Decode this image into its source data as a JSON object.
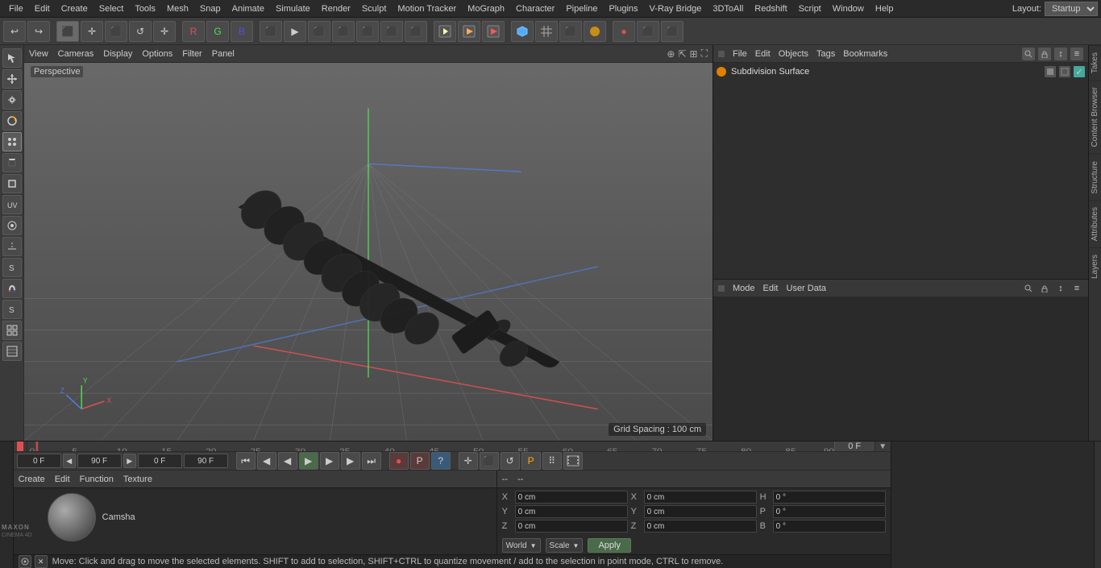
{
  "app": {
    "title": "Cinema 4D"
  },
  "menubar": {
    "items": [
      "File",
      "Edit",
      "Create",
      "Select",
      "Tools",
      "Mesh",
      "Snap",
      "Animate",
      "Simulate",
      "Render",
      "Sculpt",
      "Motion Tracker",
      "MoGraph",
      "Character",
      "Pipeline",
      "Plugins",
      "V-Ray Bridge",
      "3DToAll",
      "Redshift",
      "Script",
      "Window",
      "Help"
    ]
  },
  "layout": {
    "label": "Layout:",
    "value": "Startup"
  },
  "toolbar": {
    "buttons": [
      "↩",
      "↩",
      "⬛",
      "✛",
      "⬛",
      "↺",
      "✛",
      "R",
      "G",
      "B",
      "⬛",
      "▶",
      "⬛",
      "⬛",
      "⬛",
      "⬛",
      "⬛",
      "⬛",
      "⬛",
      "⬛",
      "⬛",
      "⬛",
      "⬛",
      "⬛",
      "⬛",
      "⬛",
      "⬛",
      "⬛",
      "⬛",
      "⬛"
    ]
  },
  "left_toolbar": {
    "buttons": [
      "⬛",
      "✛",
      "⬛",
      "⬛",
      "⬛",
      "⬛",
      "⬛",
      "⬛",
      "⬛",
      "⬛",
      "⬛",
      "⬛",
      "⬛",
      "⬛",
      "⬛",
      "⬛",
      "⬛",
      "⬛",
      "⬛"
    ]
  },
  "viewport": {
    "menus": [
      "View",
      "Cameras",
      "Display",
      "Options",
      "Filter",
      "Panel"
    ],
    "perspective_label": "Perspective",
    "grid_spacing": "Grid Spacing : 100 cm"
  },
  "object_manager": {
    "tabs": [
      "File",
      "Edit",
      "Objects",
      "Tags",
      "Bookmarks"
    ],
    "object_name": "Subdivision Surface"
  },
  "attributes": {
    "tabs": [
      "Mode",
      "Edit",
      "User Data"
    ]
  },
  "side_tabs": {
    "items": [
      "Takes",
      "Content Browser",
      "Structure",
      "Attributes",
      "Layers"
    ]
  },
  "timeline": {
    "ticks": [
      0,
      5,
      10,
      15,
      20,
      25,
      30,
      35,
      40,
      45,
      50,
      55,
      60,
      65,
      70,
      75,
      80,
      85,
      90
    ],
    "current_frame": "0 F"
  },
  "transport": {
    "start_frame": "0 F",
    "end_frame": "90 F",
    "preview_start": "0 F",
    "preview_end": "90 F",
    "buttons": [
      "⏮",
      "⏪",
      "⏪",
      "▶",
      "⏩",
      "⏩",
      "⏭"
    ]
  },
  "material": {
    "menus": [
      "Create",
      "Edit",
      "Function",
      "Texture"
    ],
    "name": "Camsha",
    "sphere_desc": "material sphere preview"
  },
  "coordinates": {
    "menus": [
      "--",
      "--"
    ],
    "fields": [
      {
        "label": "X",
        "value": "0 cm",
        "axis": "pos"
      },
      {
        "label": "Y",
        "value": "0 cm",
        "axis": "pos"
      },
      {
        "label": "Z",
        "value": "0 cm",
        "axis": "pos"
      },
      {
        "label": "X",
        "value": "0 cm",
        "axis": "size"
      },
      {
        "label": "Y",
        "value": "0 cm",
        "axis": "size"
      },
      {
        "label": "Z",
        "value": "0 cm",
        "axis": "size"
      },
      {
        "label": "H",
        "value": "0 °",
        "axis": "rot"
      },
      {
        "label": "P",
        "value": "0 °",
        "axis": "rot"
      },
      {
        "label": "B",
        "value": "0 °",
        "axis": "rot"
      }
    ],
    "row1": [
      {
        "label": "X",
        "value": "0 cm"
      },
      {
        "label": "X",
        "value": "0 cm"
      },
      {
        "label": "H",
        "value": "0 °"
      }
    ],
    "row2": [
      {
        "label": "Y",
        "value": "0 cm"
      },
      {
        "label": "Y",
        "value": "0 cm"
      },
      {
        "label": "P",
        "value": "0 °"
      }
    ],
    "row3": [
      {
        "label": "Z",
        "value": "0 cm"
      },
      {
        "label": "Z",
        "value": "0 cm"
      },
      {
        "label": "B",
        "value": "0 °"
      }
    ],
    "world_label": "World",
    "scale_label": "Scale",
    "apply_label": "Apply"
  },
  "status": {
    "text": "Move: Click and drag to move the selected elements. SHIFT to add to selection, SHIFT+CTRL to quantize movement / add to the selection in point mode, CTRL to remove."
  }
}
